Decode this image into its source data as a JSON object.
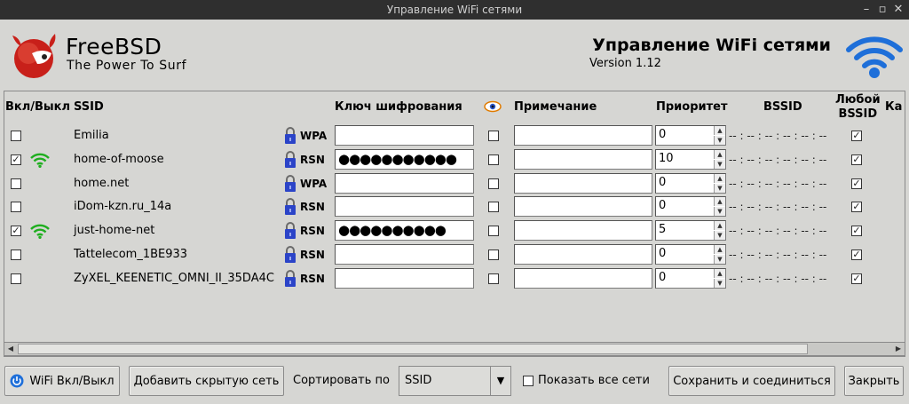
{
  "window": {
    "title": "Управление WiFi сетями"
  },
  "header": {
    "logo_name": "FreeBSD",
    "logo_tagline": "The Power To Surf",
    "app_title": "Управление WiFi сетями",
    "version": "Version 1.12"
  },
  "columns": {
    "enable": "Вкл/Выкл",
    "ssid": "SSID",
    "key": "Ключ шифрования",
    "note": "Примечание",
    "priority": "Приоритет",
    "bssid": "BSSID",
    "any_bssid_1": "Любой",
    "any_bssid_2": "BSSID",
    "cut": "Ка"
  },
  "networks": [
    {
      "enabled": "",
      "ssid": "Emilia",
      "security": "WPA",
      "key": "",
      "note": "",
      "priority": "0",
      "bssid": "-- : -- : -- : -- : -- : --",
      "any_bssid": "✓"
    },
    {
      "enabled": "✓",
      "ssid": "home-of-moose",
      "security": "RSN",
      "key": "●●●●●●●●●●●",
      "note": "",
      "priority": "10",
      "bssid": "-- : -- : -- : -- : -- : --",
      "any_bssid": "✓"
    },
    {
      "enabled": "",
      "ssid": "home.net",
      "security": "WPA",
      "key": "",
      "note": "",
      "priority": "0",
      "bssid": "-- : -- : -- : -- : -- : --",
      "any_bssid": "✓"
    },
    {
      "enabled": "",
      "ssid": "iDom-kzn.ru_14a",
      "security": "RSN",
      "key": "",
      "note": "",
      "priority": "0",
      "bssid": "-- : -- : -- : -- : -- : --",
      "any_bssid": "✓"
    },
    {
      "enabled": "✓",
      "ssid": "just-home-net",
      "security": "RSN",
      "key": "●●●●●●●●●●",
      "note": "",
      "priority": "5",
      "bssid": "-- : -- : -- : -- : -- : --",
      "any_bssid": "✓"
    },
    {
      "enabled": "",
      "ssid": "Tattelecom_1BE933",
      "security": "RSN",
      "key": "",
      "note": "",
      "priority": "0",
      "bssid": "-- : -- : -- : -- : -- : --",
      "any_bssid": "✓"
    },
    {
      "enabled": "",
      "ssid": "ZyXEL_KEENETIC_OMNI_II_35DA4C",
      "security": "RSN",
      "key": "",
      "note": "",
      "priority": "0",
      "bssid": "-- : -- : -- : -- : -- : --",
      "any_bssid": "✓"
    }
  ],
  "toolbar": {
    "wifi_toggle": "WiFi Вкл/Выкл",
    "add_hidden": "Добавить скрытую сеть",
    "sort_label": "Сортировать по",
    "sort_value": "SSID",
    "show_all": "Показать все сети",
    "save_connect": "Сохранить и соединиться",
    "close": "Закрыть"
  },
  "colors": {
    "wifi_blue": "#1e6fd9",
    "signal_green": "#1fae1f",
    "lock_blue": "#2b44c8",
    "logo_red": "#c8201a"
  },
  "icons": {
    "eye": "eye-icon",
    "lock": "lock-icon",
    "signal": "wifi-signal-icon",
    "power": "power-icon"
  }
}
